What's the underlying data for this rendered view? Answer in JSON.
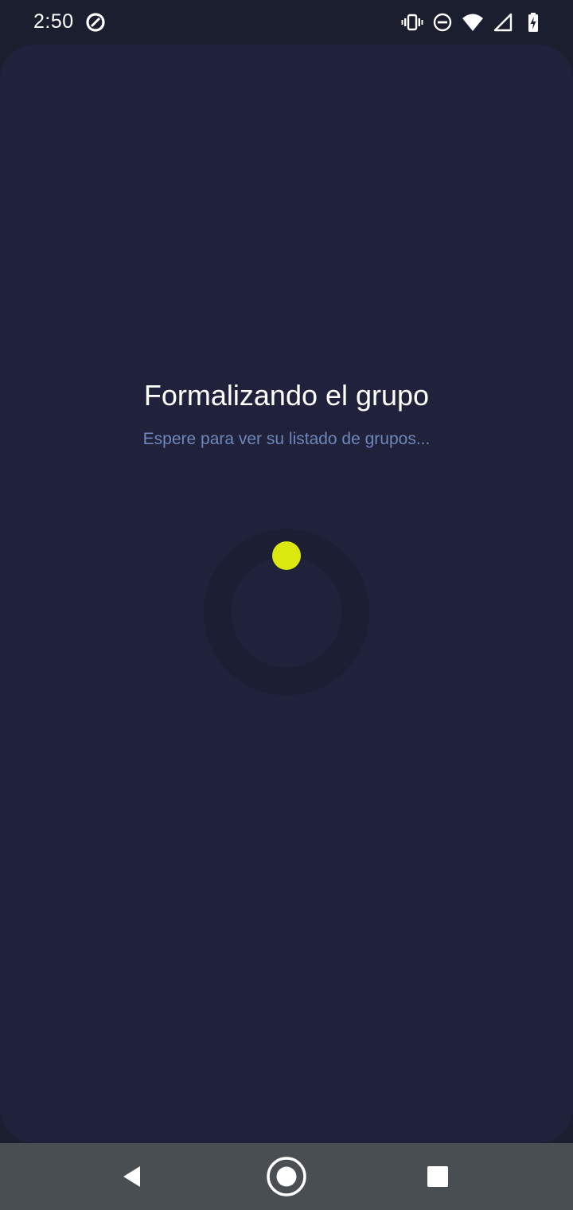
{
  "status_bar": {
    "time": "2:50",
    "left_icon": "data-saver-icon",
    "right_icons": [
      "vibrate-icon",
      "do-not-disturb-icon",
      "wifi-icon",
      "cell-signal-icon",
      "battery-charging-icon"
    ]
  },
  "main": {
    "title": "Formalizando el grupo",
    "subtitle": "Espere para ver su listado de grupos...",
    "loader": {
      "track_color": "#1c1f33",
      "dot_color": "#dbe80f"
    }
  },
  "nav_bar": {
    "items": [
      "back-icon",
      "home-icon",
      "recents-icon"
    ]
  },
  "colors": {
    "background": "#1a1e2e",
    "card": "#20223c",
    "title": "#ffffff",
    "subtitle": "#6f86b8",
    "accent": "#dbe80f",
    "nav_bar": "#494e53"
  }
}
